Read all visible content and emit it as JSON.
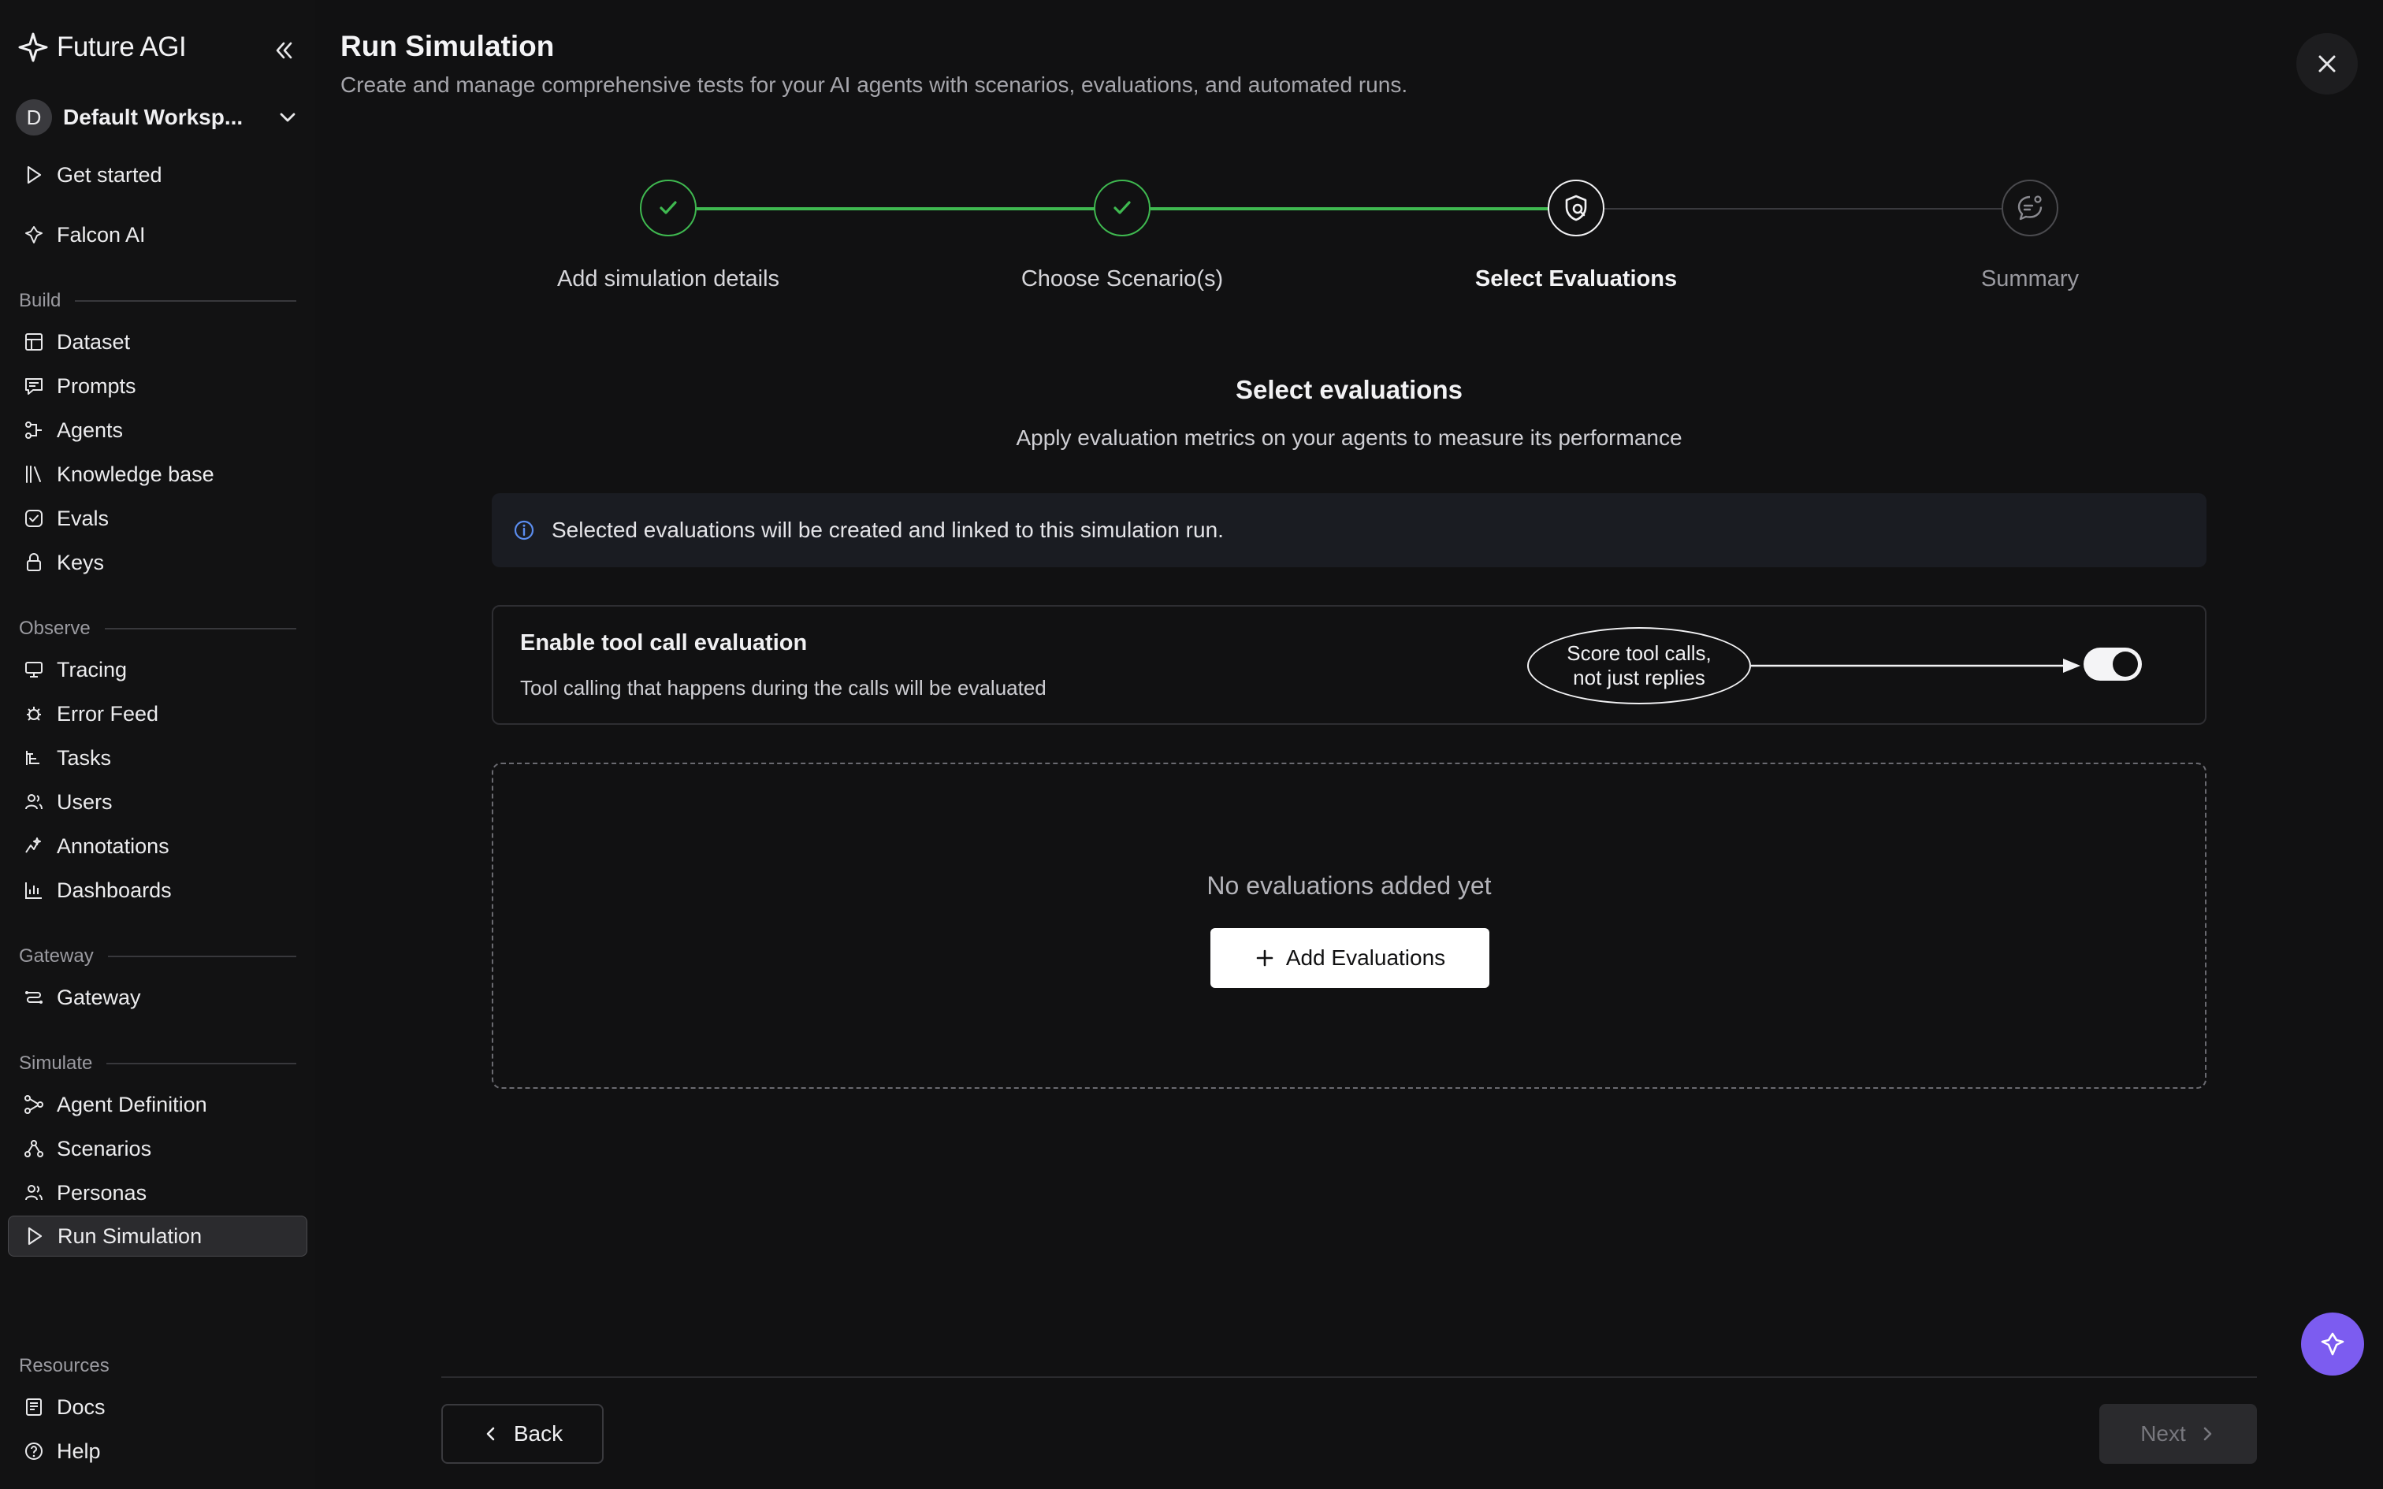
{
  "brand": {
    "name": "Future AGI",
    "icon": "future-agi-logo"
  },
  "workspace": {
    "initial": "D",
    "name": "Default Worksp..."
  },
  "nav_top": [
    {
      "label": "Get started",
      "icon": "play-icon"
    },
    {
      "label": "Falcon AI",
      "icon": "falcon-icon"
    }
  ],
  "sections": {
    "build": {
      "title": "Build",
      "items": [
        {
          "label": "Dataset",
          "icon": "table-icon"
        },
        {
          "label": "Prompts",
          "icon": "prompt-icon"
        },
        {
          "label": "Agents",
          "icon": "agents-icon"
        },
        {
          "label": "Knowledge base",
          "icon": "library-icon"
        },
        {
          "label": "Evals",
          "icon": "check-square-icon"
        },
        {
          "label": "Keys",
          "icon": "lock-icon"
        }
      ]
    },
    "observe": {
      "title": "Observe",
      "items": [
        {
          "label": "Tracing",
          "icon": "monitor-icon"
        },
        {
          "label": "Error Feed",
          "icon": "bug-icon"
        },
        {
          "label": "Tasks",
          "icon": "tasks-icon"
        },
        {
          "label": "Users",
          "icon": "users-icon"
        },
        {
          "label": "Annotations",
          "icon": "sparkle-icon"
        },
        {
          "label": "Dashboards",
          "icon": "bar-chart-icon"
        }
      ]
    },
    "gateway": {
      "title": "Gateway",
      "items": [
        {
          "label": "Gateway",
          "icon": "gateway-icon"
        }
      ]
    },
    "simulate": {
      "title": "Simulate",
      "items": [
        {
          "label": "Agent Definition",
          "icon": "nodes-icon"
        },
        {
          "label": "Scenarios",
          "icon": "branch-icon"
        },
        {
          "label": "Personas",
          "icon": "users-icon"
        },
        {
          "label": "Run Simulation",
          "icon": "play-icon",
          "active": true
        }
      ]
    },
    "resources": {
      "title": "Resources",
      "items": [
        {
          "label": "Docs",
          "icon": "docs-icon"
        },
        {
          "label": "Help",
          "icon": "help-icon"
        }
      ]
    }
  },
  "header": {
    "title": "Run Simulation",
    "subtitle": "Create and manage comprehensive tests for your AI agents with scenarios, evaluations, and automated runs."
  },
  "steps": [
    {
      "label": "Add simulation details",
      "state": "done"
    },
    {
      "label": "Choose Scenario(s)",
      "state": "done"
    },
    {
      "label": "Select Evaluations",
      "state": "current"
    },
    {
      "label": "Summary",
      "state": "todo"
    }
  ],
  "section": {
    "title": "Select evaluations",
    "subtitle": "Apply evaluation metrics on your agents to measure its performance"
  },
  "info_banner": {
    "text": "Selected evaluations will be created and linked to this simulation run."
  },
  "tool_call": {
    "title": "Enable tool call evaluation",
    "description": "Tool calling that happens during the calls will be evaluated",
    "enabled": true
  },
  "callout": {
    "line1": "Score tool calls,",
    "line2": "not just replies"
  },
  "empty_state": {
    "text": "No evaluations added yet",
    "button": "Add Evaluations"
  },
  "footer": {
    "back": "Back",
    "next": "Next"
  },
  "colors": {
    "accent_green": "#3fb950",
    "fab_purple": "#7c5cf0",
    "background": "#111112"
  }
}
